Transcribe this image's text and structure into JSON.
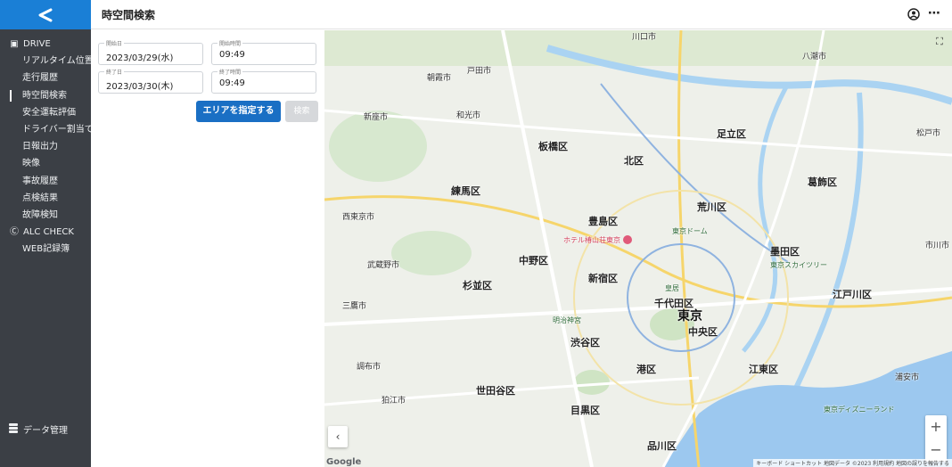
{
  "app": {
    "page_title": "時空間検索",
    "logo_icon": "back-arrow-icon",
    "accent": "#1a7fd6"
  },
  "sidebar": {
    "items": [
      {
        "label": "DRIVE",
        "icon": "car-icon",
        "group": true
      },
      {
        "label": "リアルタイム位置"
      },
      {
        "label": "走行履歴"
      },
      {
        "label": "時空間検索",
        "active": true
      },
      {
        "label": "安全運転評価"
      },
      {
        "label": "ドライバー割当て"
      },
      {
        "label": "日報出力"
      },
      {
        "label": "映像"
      },
      {
        "label": "事故履歴"
      },
      {
        "label": "点検結果"
      },
      {
        "label": "故障検知"
      },
      {
        "label": "ALC CHECK",
        "icon": "alc-icon",
        "group": true
      },
      {
        "label": "WEB記録簿"
      }
    ],
    "data_management": "データ管理"
  },
  "form": {
    "start_date_label": "開始日",
    "start_date": "2023/03/29(水)",
    "start_time_label": "開始時間",
    "start_time": "09:49",
    "end_date_label": "終了日",
    "end_date": "2023/03/30(木)",
    "end_time_label": "終了時間",
    "end_time": "09:49",
    "area_button": "エリアを指定する",
    "search_button": "検索"
  },
  "map": {
    "wards": [
      "練馬区",
      "板橋区",
      "北区",
      "足立区",
      "葛飾区",
      "豊島区",
      "荒川区",
      "中野区",
      "杉並区",
      "新宿区",
      "千代田区",
      "中央区",
      "渋谷区",
      "港区",
      "江東区",
      "江戸川区",
      "世田谷区",
      "目黒区",
      "品川区",
      "墨田区"
    ],
    "cities": [
      "戸田市",
      "和光市",
      "新座市",
      "川口市",
      "八潮市",
      "西東京市",
      "武蔵野市",
      "三鷹市",
      "調布市",
      "狛江市",
      "浦安市",
      "市川市",
      "松戸市",
      "朝霞市"
    ],
    "center_city": "東京",
    "pois": [
      "ホテル椿山荘東京",
      "東京スカイツリー",
      "東京ディズニーランド",
      "皇居",
      "東京ドーム",
      "明治神宮"
    ],
    "google": "Google",
    "attribution": "キーボード ショートカット  地図データ ©2023  利用規約  地図の誤りを報告する"
  }
}
